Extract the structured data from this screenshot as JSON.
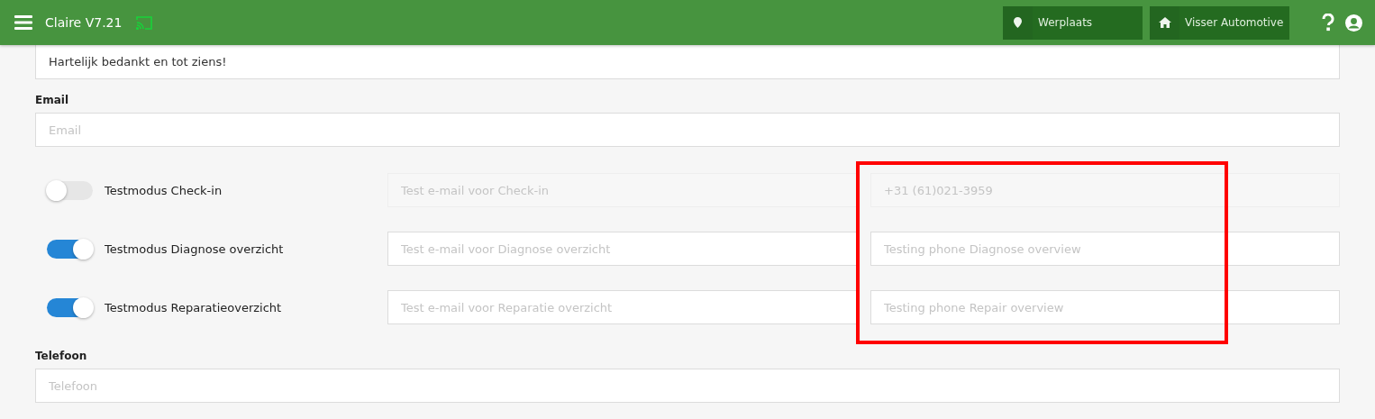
{
  "header": {
    "title": "Claire V7.21",
    "location": "Werplaats",
    "company": "Visser Automotive"
  },
  "message_field": {
    "value": "Hartelijk bedankt en tot ziens!"
  },
  "email": {
    "label": "Email",
    "placeholder": "Email"
  },
  "test_modes": [
    {
      "label": "Testmodus Check-in",
      "on": false,
      "email_placeholder": "Test e-mail voor Check-in",
      "phone_value": "+31 (61)021-3959"
    },
    {
      "label": "Testmodus Diagnose overzicht",
      "on": true,
      "email_placeholder": "Test e-mail voor Diagnose overzicht",
      "phone_placeholder": "Testing phone Diagnose overview"
    },
    {
      "label": "Testmodus Reparatieoverzicht",
      "on": true,
      "email_placeholder": "Test e-mail voor Reparatie overzicht",
      "phone_placeholder": "Testing phone Repair overview"
    }
  ],
  "phone": {
    "label": "Telefoon",
    "placeholder": "Telefoon"
  },
  "annotations": [
    {
      "kind": "rectangle",
      "color": "#ff0000"
    }
  ]
}
